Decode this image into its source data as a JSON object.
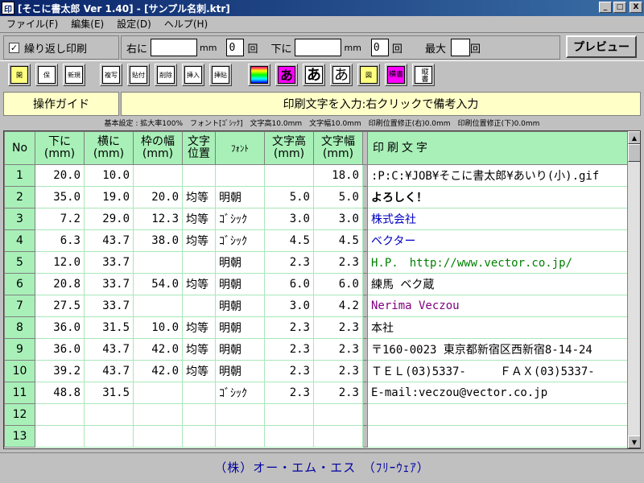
{
  "window": {
    "icon_text": "印",
    "title": "[そこに書太郎 Ver 1.40] - [サンプル名刺.ktr]",
    "minimize": "_",
    "maximize": "□",
    "close": "X"
  },
  "menu": [
    "ファイル(F)",
    "編集(E)",
    "設定(D)",
    "ヘルプ(H)"
  ],
  "repeat_print": {
    "label": "繰り返し印刷",
    "checked": "✓"
  },
  "offsets": {
    "right_label": "右に",
    "right_value": "",
    "right_unit": "mm",
    "right_count": "0",
    "right_count_label": "回",
    "down_label": "下に",
    "down_value": "",
    "down_unit": "mm",
    "down_count": "0",
    "down_count_label": "回",
    "max_label": "最大",
    "max_value": "",
    "max_suffix": "回"
  },
  "preview_button": "プレビュー",
  "toolbar": [
    {
      "name": "open-file",
      "text": "開"
    },
    {
      "name": "save-file",
      "text": "保"
    },
    {
      "name": "new-file",
      "text": "新規"
    },
    {
      "name": "copy-row",
      "text": "複写"
    },
    {
      "name": "paste-row",
      "text": "貼付"
    },
    {
      "name": "delete-row",
      "text": "削除"
    },
    {
      "name": "insert-row",
      "text": "挿入"
    },
    {
      "name": "paste-insert",
      "text": "挿貼"
    },
    {
      "name": "color",
      "text": ""
    },
    {
      "name": "font-mincho",
      "text": "あ"
    },
    {
      "name": "font-gothic",
      "text": "あ"
    },
    {
      "name": "font-serif",
      "text": "あ"
    },
    {
      "name": "image",
      "text": "図"
    },
    {
      "name": "horizontal-writing",
      "text": "横書"
    },
    {
      "name": "vertical-writing",
      "text": "縦書"
    }
  ],
  "guide": {
    "button": "操作ガイド",
    "text": "印刷文字を入力:右クリックで備考入力"
  },
  "settings_line": "基本設定 : 拡大率100%　フォント[ｺﾞｼｯｸ]　文字高10.0mm　文字幅10.0mm　印刷位置修正(右)0.0mm　印刷位置修正(下)0.0mm",
  "columns": {
    "no": "No",
    "down": [
      "下に",
      "(mm)"
    ],
    "right": [
      "横に",
      "(mm)"
    ],
    "frame": [
      "枠の幅",
      "(mm)"
    ],
    "align": [
      "文字",
      "位置"
    ],
    "font": "ﾌｫﾝﾄ",
    "height": [
      "文字高",
      "(mm)"
    ],
    "width": [
      "文字幅",
      "(mm)"
    ],
    "text": "印刷文字"
  },
  "rows": [
    {
      "no": "1",
      "down": "20.0",
      "right": "10.0",
      "frame": "",
      "align": "",
      "font": "",
      "height": "",
      "width": "18.0",
      "text": ":P:C:¥JOB¥そこに書太郎¥あいり(小).gif",
      "color": "#000000"
    },
    {
      "no": "2",
      "down": "35.0",
      "right": "19.0",
      "frame": "20.0",
      "align": "均等",
      "font": "明朝",
      "height": "5.0",
      "width": "5.0",
      "text": "よろしく！",
      "color": "#000000",
      "bold": true
    },
    {
      "no": "3",
      "down": "7.2",
      "right": "29.0",
      "frame": "12.3",
      "align": "均等",
      "font": "ｺﾞｼｯｸ",
      "height": "3.0",
      "width": "3.0",
      "text": "株式会社",
      "color": "#0000c0"
    },
    {
      "no": "4",
      "down": "6.3",
      "right": "43.7",
      "frame": "38.0",
      "align": "均等",
      "font": "ｺﾞｼｯｸ",
      "height": "4.5",
      "width": "4.5",
      "text": "ベクター",
      "color": "#0000c0"
    },
    {
      "no": "5",
      "down": "12.0",
      "right": "33.7",
      "frame": "",
      "align": "",
      "font": "明朝",
      "height": "2.3",
      "width": "2.3",
      "text": "H.P.　http://www.vector.co.jp/",
      "color": "#008000"
    },
    {
      "no": "6",
      "down": "20.8",
      "right": "33.7",
      "frame": "54.0",
      "align": "均等",
      "font": "明朝",
      "height": "6.0",
      "width": "6.0",
      "text": "練馬 ベク蔵",
      "color": "#000000"
    },
    {
      "no": "7",
      "down": "27.5",
      "right": "33.7",
      "frame": "",
      "align": "",
      "font": "明朝",
      "height": "3.0",
      "width": "4.2",
      "text": "Nerima Veczou",
      "color": "#800080"
    },
    {
      "no": "8",
      "down": "36.0",
      "right": "31.5",
      "frame": "10.0",
      "align": "均等",
      "font": "明朝",
      "height": "2.3",
      "width": "2.3",
      "text": "本社",
      "color": "#000000"
    },
    {
      "no": "9",
      "down": "36.0",
      "right": "43.7",
      "frame": "42.0",
      "align": "均等",
      "font": "明朝",
      "height": "2.3",
      "width": "2.3",
      "text": "〒160-0023 東京都新宿区西新宿8-14-24",
      "color": "#000000"
    },
    {
      "no": "10",
      "down": "39.2",
      "right": "43.7",
      "frame": "42.0",
      "align": "均等",
      "font": "明朝",
      "height": "2.3",
      "width": "2.3",
      "text": "ＴＥＬ(03)5337-　　　ＦＡＸ(03)5337-",
      "color": "#000000"
    },
    {
      "no": "11",
      "down": "48.8",
      "right": "31.5",
      "frame": "",
      "align": "",
      "font": "ｺﾞｼｯｸ",
      "height": "2.3",
      "width": "2.3",
      "text": "E-mail:veczou@vector.co.jp",
      "color": "#000000"
    },
    {
      "no": "12",
      "down": "",
      "right": "",
      "frame": "",
      "align": "",
      "font": "",
      "height": "",
      "width": "",
      "text": "",
      "color": "#000000"
    },
    {
      "no": "13",
      "down": "",
      "right": "",
      "frame": "",
      "align": "",
      "font": "",
      "height": "",
      "width": "",
      "text": "",
      "color": "#000000"
    }
  ],
  "scroll": {
    "up": "▲",
    "down": "▼"
  },
  "status": "（株）オー・エム・エス　（ﾌﾘｰｳｪｱ）"
}
